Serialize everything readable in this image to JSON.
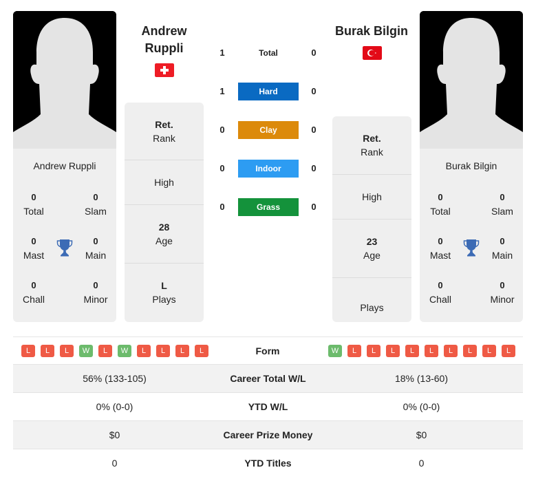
{
  "colors": {
    "hard": "#0a6ac2",
    "clay": "#dc8a0b",
    "indoor": "#2d9cf2",
    "grass": "#14923b",
    "win": "#6cbb6c",
    "loss": "#ef5a45",
    "trophy": "#3c6bb5"
  },
  "player1": {
    "name": "Andrew Ruppli",
    "flag_icon": "switzerland-flag-icon",
    "titles": {
      "total": {
        "value": "0",
        "label": "Total"
      },
      "slam": {
        "value": "0",
        "label": "Slam"
      },
      "mast": {
        "value": "0",
        "label": "Mast"
      },
      "main": {
        "value": "0",
        "label": "Main"
      },
      "chall": {
        "value": "0",
        "label": "Chall"
      },
      "minor": {
        "value": "0",
        "label": "Minor"
      }
    },
    "info": {
      "rank": {
        "value": "Ret.",
        "label": "Rank"
      },
      "high": {
        "value": "",
        "label": "High"
      },
      "age": {
        "value": "28",
        "label": "Age"
      },
      "plays": {
        "value": "L",
        "label": "Plays"
      }
    },
    "form": [
      "L",
      "L",
      "L",
      "W",
      "L",
      "W",
      "L",
      "L",
      "L",
      "L"
    ]
  },
  "player2": {
    "name": "Burak Bilgin",
    "flag_icon": "turkey-flag-icon",
    "titles": {
      "total": {
        "value": "0",
        "label": "Total"
      },
      "slam": {
        "value": "0",
        "label": "Slam"
      },
      "mast": {
        "value": "0",
        "label": "Mast"
      },
      "main": {
        "value": "0",
        "label": "Main"
      },
      "chall": {
        "value": "0",
        "label": "Chall"
      },
      "minor": {
        "value": "0",
        "label": "Minor"
      }
    },
    "info": {
      "rank": {
        "value": "Ret.",
        "label": "Rank"
      },
      "high": {
        "value": "",
        "label": "High"
      },
      "age": {
        "value": "23",
        "label": "Age"
      },
      "plays": {
        "value": "",
        "label": "Plays"
      }
    },
    "form": [
      "W",
      "L",
      "L",
      "L",
      "L",
      "L",
      "L",
      "L",
      "L",
      "L"
    ]
  },
  "h2h": [
    {
      "label": "Total",
      "left": "1",
      "right": "0"
    },
    {
      "label": "Hard",
      "left": "1",
      "right": "0"
    },
    {
      "label": "Clay",
      "left": "0",
      "right": "0"
    },
    {
      "label": "Indoor",
      "left": "0",
      "right": "0"
    },
    {
      "label": "Grass",
      "left": "0",
      "right": "0"
    }
  ],
  "form_label": "Form",
  "stats": [
    {
      "label": "Career Total W/L",
      "left": "56% (133-105)",
      "right": "18% (13-60)"
    },
    {
      "label": "YTD W/L",
      "left": "0% (0-0)",
      "right": "0% (0-0)"
    },
    {
      "label": "Career Prize Money",
      "left": "$0",
      "right": "$0"
    },
    {
      "label": "YTD Titles",
      "left": "0",
      "right": "0"
    }
  ]
}
